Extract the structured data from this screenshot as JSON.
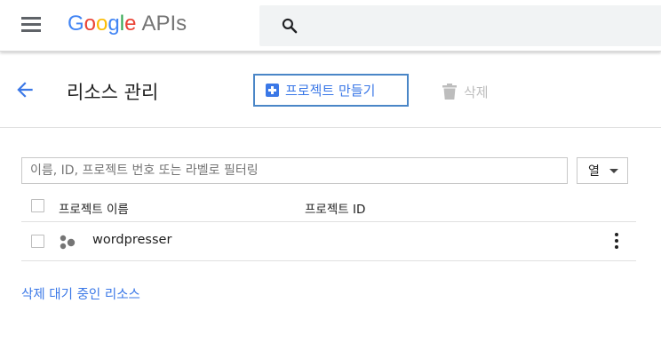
{
  "header": {
    "logo": {
      "g1": "G",
      "g2": "o",
      "g3": "o",
      "g4": "g",
      "g5": "l",
      "g6": "e",
      "suffix": "APIs"
    },
    "search": {
      "value": "",
      "placeholder": ""
    },
    "icons": {
      "menu": "hamburger-menu-icon",
      "search": "search-icon"
    }
  },
  "page": {
    "title": "리소스 관리",
    "create_button": "프로젝트 만들기",
    "delete_button": "삭제",
    "icons": {
      "back": "arrow-back-icon",
      "create": "add-box-icon",
      "delete": "trash-icon"
    }
  },
  "filter": {
    "placeholder": "이름, ID, 프로젝트 번호 또는 라벨로 필터링",
    "value": "",
    "columns_button": "열"
  },
  "table": {
    "headers": {
      "name": "프로젝트 이름",
      "id": "프로젝트 ID"
    },
    "rows": [
      {
        "name": "wordpresser",
        "id": "",
        "icon": "project-icon"
      }
    ]
  },
  "footer": {
    "pending_deletion_link": "삭제 대기 중인 리소스"
  },
  "colors": {
    "accent": "#3b78e7",
    "button_border": "#4a86c7",
    "disabled": "#bdbdbd"
  }
}
